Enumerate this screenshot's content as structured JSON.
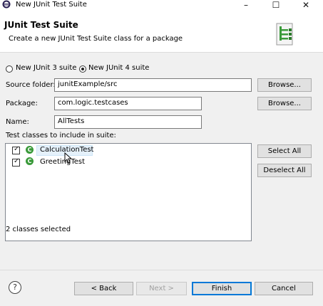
{
  "window": {
    "title": "New JUnit Test Suite",
    "controls": [
      "–",
      "☐",
      "✕"
    ]
  },
  "banner": {
    "title": "JUnit Test Suite",
    "description": "Create a new JUnit Test Suite class for a package",
    "icon": "test-suite-wizard-icon"
  },
  "junit_version": {
    "options": [
      "New JUnit 3 suite",
      "New JUnit 4 suite"
    ],
    "selected": "New JUnit 4 suite"
  },
  "form": {
    "source_folder": {
      "label": "Source folder:",
      "value": "junitExample/src",
      "browse": "Browse..."
    },
    "package": {
      "label": "Package:",
      "value": "com.logic.testcases",
      "browse": "Browse..."
    },
    "name": {
      "label": "Name:",
      "value": "AllTests"
    }
  },
  "test_classes": {
    "label": "Test classes to include in suite:",
    "items": [
      {
        "name": "CalculationTest",
        "checked": true,
        "icon_letter": "C"
      },
      {
        "name": "GreetingTest",
        "checked": true,
        "icon_letter": "C"
      }
    ],
    "select_all": "Select All",
    "deselect_all": "Deselect All",
    "status": "2 classes selected"
  },
  "footer": {
    "help": "?",
    "back": "< Back",
    "next": "Next >",
    "finish": "Finish",
    "cancel": "Cancel"
  },
  "colors": {
    "accent": "#0078d7",
    "class_icon": "#3a9a3a"
  }
}
